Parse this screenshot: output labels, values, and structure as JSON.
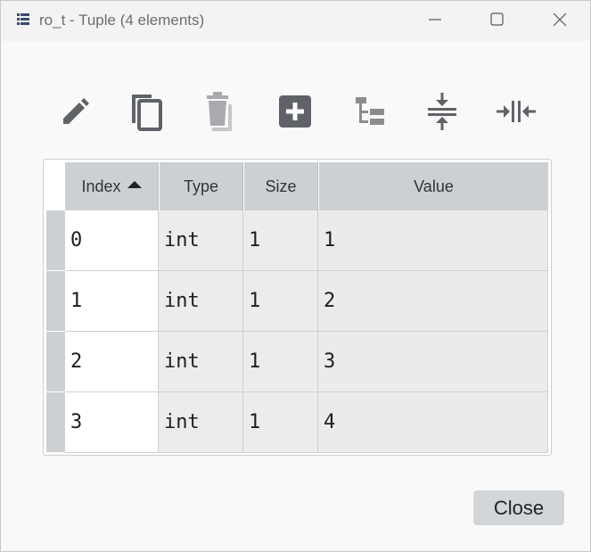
{
  "window": {
    "title": "ro_t - Tuple (4 elements)",
    "icon": "table-list-icon",
    "controls": [
      "minimize-icon",
      "maximize-icon",
      "close-icon"
    ]
  },
  "toolbar": {
    "tools": [
      {
        "name": "edit",
        "icon": "pencil-icon"
      },
      {
        "name": "copy",
        "icon": "copy-icon"
      },
      {
        "name": "delete",
        "icon": "trash-icon"
      },
      {
        "name": "insert",
        "icon": "plus-square-icon"
      },
      {
        "name": "toggle-tree",
        "icon": "tree-icon"
      },
      {
        "name": "resize-rows",
        "icon": "collapse-vertical-icon"
      },
      {
        "name": "resize-columns",
        "icon": "collapse-horizontal-icon"
      }
    ]
  },
  "table": {
    "headers": {
      "index": "Index",
      "type": "Type",
      "size": "Size",
      "value": "Value"
    },
    "sort": {
      "column": "index",
      "direction": "ascending"
    },
    "rows": [
      {
        "index": "0",
        "type": "int",
        "size": "1",
        "value": "1"
      },
      {
        "index": "1",
        "type": "int",
        "size": "1",
        "value": "2"
      },
      {
        "index": "2",
        "type": "int",
        "size": "1",
        "value": "3"
      },
      {
        "index": "3",
        "type": "int",
        "size": "1",
        "value": "4"
      }
    ]
  },
  "footer": {
    "close_label": "Close"
  },
  "colors": {
    "header_bg": "#cdd0d3",
    "icon_gray": "#5f6368",
    "button_bg": "#d3d6d9"
  }
}
